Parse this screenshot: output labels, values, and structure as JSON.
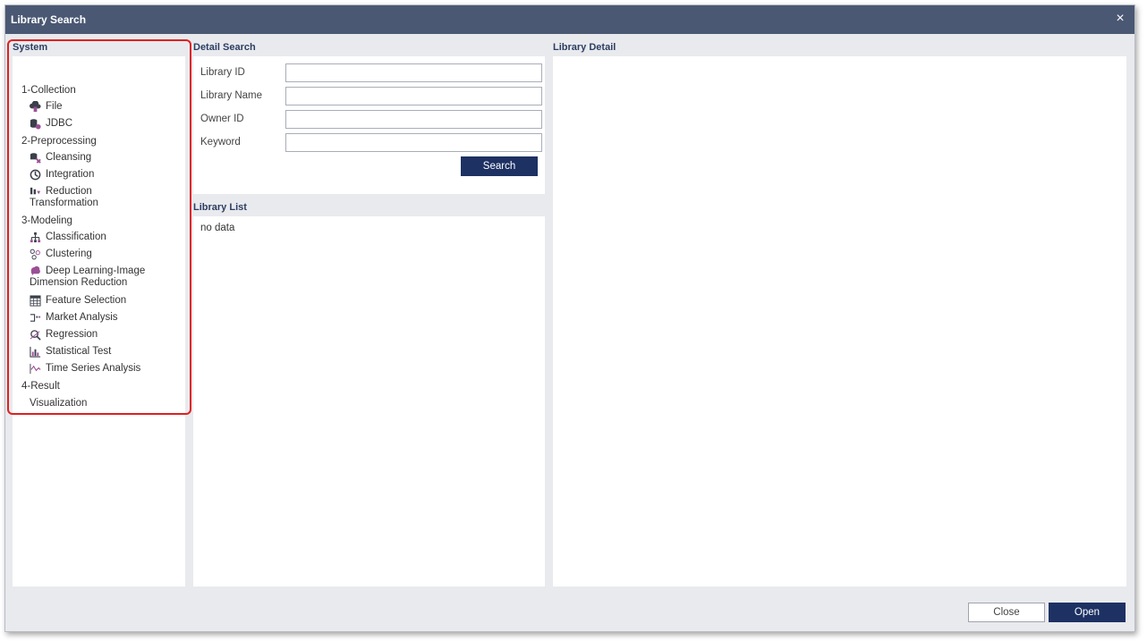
{
  "window": {
    "title": "Library Search",
    "close_glyph": "×"
  },
  "system": {
    "heading": "System",
    "tree": [
      {
        "label": "1-Collection",
        "items": [
          {
            "label": "File",
            "icon": "file-cloud-icon"
          },
          {
            "label": "JDBC",
            "icon": "database-icon"
          }
        ]
      },
      {
        "label": "2-Preprocessing",
        "items": [
          {
            "label": "Cleansing",
            "icon": "cleansing-icon"
          },
          {
            "label": "Integration",
            "icon": "integration-icon"
          },
          {
            "label": "Reduction",
            "icon": "reduction-icon"
          }
        ],
        "trailing": "Transformation"
      },
      {
        "label": "3-Modeling",
        "items": [
          {
            "label": "Classification",
            "icon": "classification-icon"
          },
          {
            "label": "Clustering",
            "icon": "clustering-icon"
          },
          {
            "label": "Deep Learning-Image",
            "icon": "brain-icon"
          }
        ],
        "mid": "Dimension Reduction",
        "items2": [
          {
            "label": "Feature Selection",
            "icon": "table-icon"
          },
          {
            "label": "Market Analysis",
            "icon": "market-analysis-icon"
          },
          {
            "label": "Regression",
            "icon": "regression-icon"
          },
          {
            "label": "Statistical Test",
            "icon": "bar-chart-icon"
          },
          {
            "label": "Time Series Analysis",
            "icon": "line-chart-icon"
          }
        ]
      },
      {
        "label": "4-Result",
        "items": [],
        "trailing": "Visualization"
      }
    ]
  },
  "detail_search": {
    "heading": "Detail Search",
    "fields": [
      {
        "label": "Library ID",
        "value": ""
      },
      {
        "label": "Library Name",
        "value": ""
      },
      {
        "label": "Owner ID",
        "value": ""
      },
      {
        "label": "Keyword",
        "value": ""
      }
    ],
    "search_label": "Search"
  },
  "library_list": {
    "heading": "Library List",
    "empty_text": "no data"
  },
  "library_detail": {
    "heading": "Library Detail"
  },
  "footer": {
    "close_label": "Close",
    "open_label": "Open"
  },
  "colors": {
    "titlebar": "#4a5873",
    "primary": "#1d3163",
    "highlight": "#e02020",
    "icon_accent": "#9b4f96"
  }
}
